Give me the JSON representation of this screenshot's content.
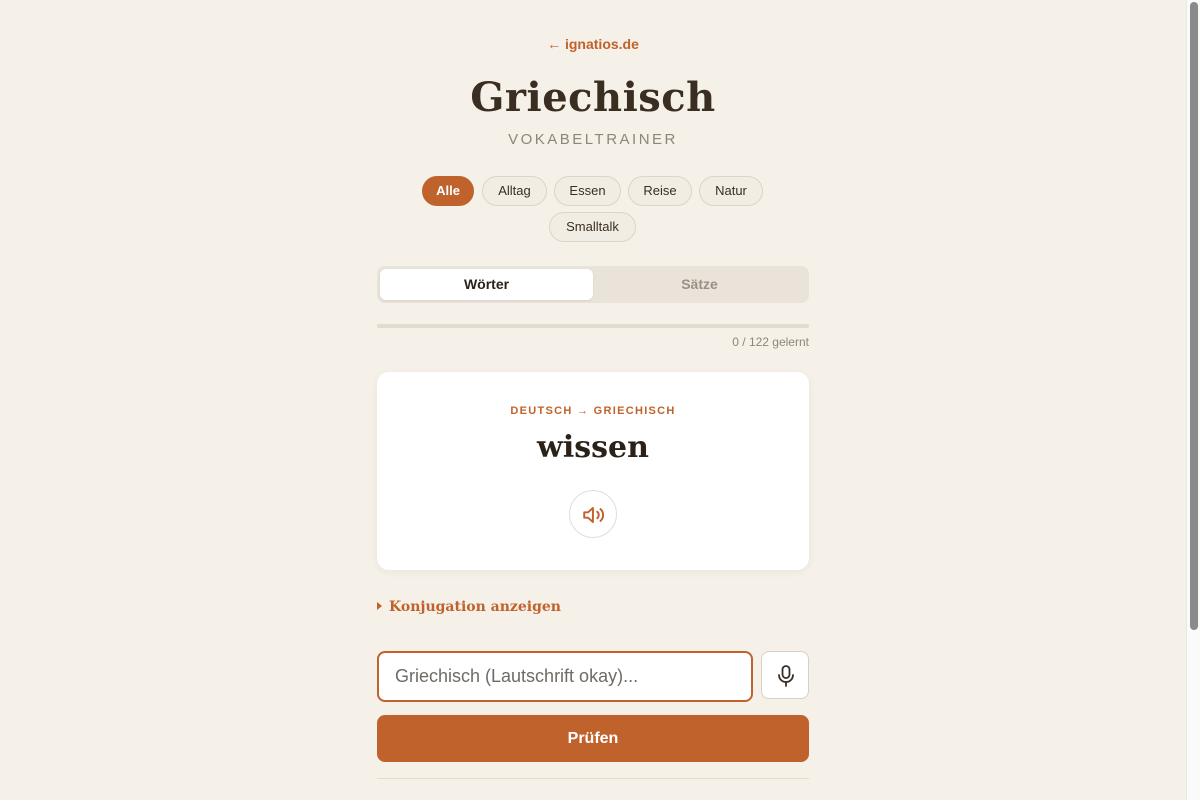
{
  "header": {
    "back_link": "← ignatios.de",
    "title": "Griechisch",
    "subtitle": "VOKABELTRAINER"
  },
  "categories": [
    {
      "label": "Alle",
      "active": true
    },
    {
      "label": "Alltag",
      "active": false
    },
    {
      "label": "Essen",
      "active": false
    },
    {
      "label": "Reise",
      "active": false
    },
    {
      "label": "Natur",
      "active": false
    },
    {
      "label": "Smalltalk",
      "active": false
    }
  ],
  "mode_tabs": {
    "words": "Wörter",
    "sentences": "Sätze",
    "selected": "words"
  },
  "progress": {
    "learned": 0,
    "total": 122,
    "text": "0 / 122 gelernt"
  },
  "card": {
    "direction": "DEUTSCH → GRIECHISCH",
    "word": "wissen",
    "speak_icon": "speaker-icon"
  },
  "conjugation_toggle": "Konjugation anzeigen",
  "answer": {
    "placeholder": "Griechisch (Lautschrift okay)...",
    "value": ""
  },
  "mic_icon": "microphone-icon",
  "check_button": "Prüfen",
  "colors": {
    "accent": "#c0622b",
    "background": "#f5f0e8",
    "text": "#3a2e22"
  }
}
